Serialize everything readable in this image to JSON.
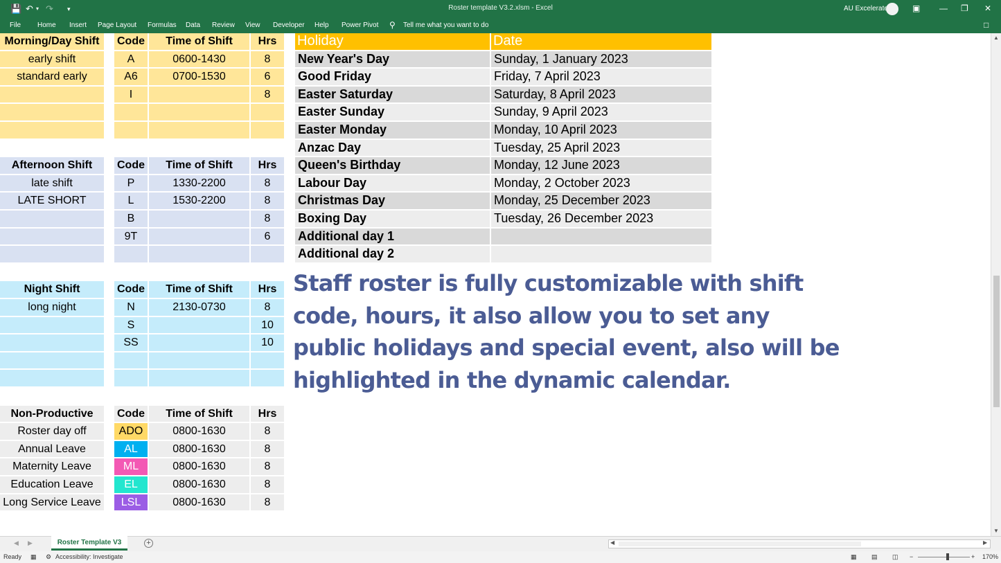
{
  "window": {
    "title": "Roster template V3.2.xlsm - Excel",
    "user_name": "AU Excelerate",
    "tell_me": "Tell me what you want to do"
  },
  "ribbon_tabs": [
    "File",
    "Home",
    "Insert",
    "Page Layout",
    "Formulas",
    "Data",
    "Review",
    "View",
    "Developer",
    "Help",
    "Power Pivot"
  ],
  "icons": {
    "save": "save-icon",
    "undo": "undo-icon",
    "redo": "redo-icon",
    "customize": "customize-qat-icon",
    "lightbulb": "lightbulb-icon",
    "ribbon_display": "ribbon-display-icon",
    "minimize": "minimize-icon",
    "restore": "restore-icon",
    "close": "close-icon",
    "comments": "comments-icon"
  },
  "shift_headers": {
    "code": "Code",
    "time": "Time of Shift",
    "hrs": "Hrs"
  },
  "morning": {
    "title": "Morning/Day Shift",
    "rows": [
      {
        "name": "early shift",
        "code": "A",
        "time": "0600-1430",
        "hrs": "8"
      },
      {
        "name": "standard early",
        "code": "A6",
        "time": "0700-1530",
        "hrs": "6"
      },
      {
        "name": "",
        "code": "I",
        "time": "",
        "hrs": "8"
      },
      {
        "name": "",
        "code": "",
        "time": "",
        "hrs": ""
      },
      {
        "name": "",
        "code": "",
        "time": "",
        "hrs": ""
      }
    ]
  },
  "afternoon": {
    "title": "Afternoon Shift",
    "rows": [
      {
        "name": "late shift",
        "code": "P",
        "time": "1330-2200",
        "hrs": "8"
      },
      {
        "name": "LATE SHORT",
        "code": "L",
        "time": "1530-2200",
        "hrs": "8"
      },
      {
        "name": "",
        "code": "B",
        "time": "",
        "hrs": "8"
      },
      {
        "name": "",
        "code": "9T",
        "time": "",
        "hrs": "6"
      },
      {
        "name": "",
        "code": "",
        "time": "",
        "hrs": ""
      }
    ]
  },
  "night": {
    "title": "Night Shift",
    "rows": [
      {
        "name": "long night",
        "code": "N",
        "time": "2130-0730",
        "hrs": "8"
      },
      {
        "name": "",
        "code": "S",
        "time": "",
        "hrs": "10"
      },
      {
        "name": "",
        "code": "SS",
        "time": "",
        "hrs": "10"
      },
      {
        "name": "",
        "code": "",
        "time": "",
        "hrs": ""
      },
      {
        "name": "",
        "code": "",
        "time": "",
        "hrs": ""
      }
    ]
  },
  "nonproductive": {
    "title": "Non-Productive",
    "rows": [
      {
        "name": "Roster day off",
        "code": "ADO",
        "time": "0800-1630",
        "hrs": "8",
        "color": "#ffd966",
        "text_color": "#000000"
      },
      {
        "name": "Annual Leave",
        "code": "AL",
        "time": "0800-1630",
        "hrs": "8",
        "color": "#00b0f0",
        "text_color": "#ffffff"
      },
      {
        "name": "Maternity Leave",
        "code": "ML",
        "time": "0800-1630",
        "hrs": "8",
        "color": "#f359b4",
        "text_color": "#ffffff"
      },
      {
        "name": "Education Leave",
        "code": "EL",
        "time": "0800-1630",
        "hrs": "8",
        "color": "#23e6cf",
        "text_color": "#ffffff"
      },
      {
        "name": "Long Service Leave",
        "code": "LSL",
        "time": "0800-1630",
        "hrs": "8",
        "color": "#9b5de5",
        "text_color": "#ffffff"
      }
    ]
  },
  "holidays": {
    "header_holiday": "Holiday",
    "header_date": "Date",
    "rows": [
      {
        "name": "New Year's Day",
        "date": "Sunday, 1 January 2023"
      },
      {
        "name": "Good Friday",
        "date": "Friday, 7 April 2023"
      },
      {
        "name": "Easter Saturday",
        "date": "Saturday, 8 April 2023"
      },
      {
        "name": "Easter Sunday",
        "date": "Sunday, 9 April 2023"
      },
      {
        "name": "Easter Monday",
        "date": "Monday, 10 April 2023"
      },
      {
        "name": "Anzac Day",
        "date": "Tuesday, 25 April 2023"
      },
      {
        "name": "Queen's Birthday",
        "date": "Monday, 12 June 2023"
      },
      {
        "name": "Labour Day",
        "date": "Monday, 2 October 2023"
      },
      {
        "name": "Christmas Day",
        "date": "Monday, 25 December 2023"
      },
      {
        "name": "Boxing Day",
        "date": "Tuesday, 26 December 2023"
      },
      {
        "name": "Additional day 1",
        "date": ""
      },
      {
        "name": "Additional day 2",
        "date": ""
      }
    ]
  },
  "promo_text": "Staff roster is fully customizable with shift code, hours, it also allow you to set any public holidays and special event, also will be highlighted in the dynamic calendar.",
  "sheet_tab": "Roster Template V3",
  "status": {
    "ready": "Ready",
    "accessibility": "Accessibility: Investigate",
    "zoom": "170%"
  }
}
